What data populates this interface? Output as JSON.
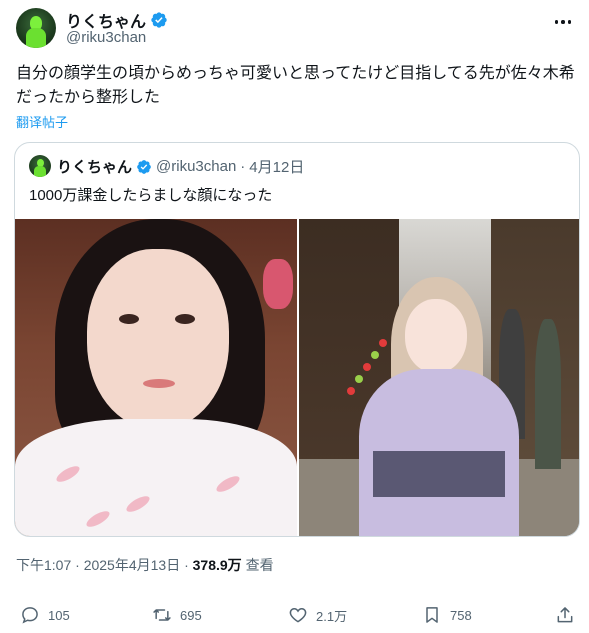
{
  "author": {
    "display_name": "りくちゃん",
    "handle": "@riku3chan"
  },
  "tweet": {
    "text": "自分の顔学生の頃からめっちゃ可愛いと思ってたけど目指してる先が佐々木希だったから整形した",
    "translate_label": "翻译帖子"
  },
  "quote": {
    "display_name": "りくちゃん",
    "handle": "@riku3chan",
    "separator": "·",
    "date": "4月12日",
    "text": "1000万課金したらましな顔になった"
  },
  "meta": {
    "time": "下午1:07 · 2025年4月13日 ·",
    "views_count": "378.9万",
    "views_label": "查看"
  },
  "actions": {
    "replies": "105",
    "reposts": "695",
    "likes": "2.1万",
    "bookmarks": "758"
  },
  "colors": {
    "text": "#0f1419",
    "secondary": "#536471",
    "link": "#1d9bf0",
    "border": "#cfd9de"
  }
}
